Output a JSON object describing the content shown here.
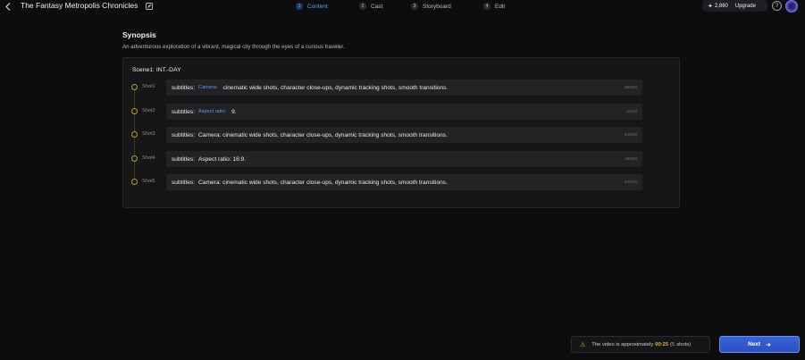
{
  "header": {
    "project_title": "The Fantasy Metropolis Chronicles",
    "steps": [
      {
        "number": "1",
        "label": "Content"
      },
      {
        "number": "2",
        "label": "Cast"
      },
      {
        "number": "3",
        "label": "Storyboard"
      },
      {
        "number": "4",
        "label": "Edit"
      }
    ],
    "active_step": "Content",
    "credits": "2,860",
    "upgrade_label": "Upgrade",
    "help_glyph": "?"
  },
  "synopsis": {
    "title": "Synopsis",
    "text": "An adventurous exploration of a vibrant, magical city through the eyes of a curious traveler."
  },
  "scene": {
    "title": "Scene1: INT.-DAY",
    "shots": [
      {
        "label": "Shot1",
        "prefix": "subtitles:",
        "tag": "Camera:",
        "text": "cinematic wide shots, character close-ups, dynamic tracking shots, smooth transitions.",
        "counter": "96/200"
      },
      {
        "label": "Shot2",
        "prefix": "subtitles:",
        "tag": "Aspect ratio:",
        "text": "9.",
        "counter": "2/200"
      },
      {
        "label": "Shot3",
        "prefix": "subtitles:",
        "tag": "",
        "text": "Camera: cinematic wide shots, character close-ups, dynamic tracking shots, smooth transitions.",
        "counter": "94/200"
      },
      {
        "label": "Shot4",
        "prefix": "subtitles:",
        "tag": "",
        "text": "Aspect ratio: 16:9.",
        "counter": "18/200"
      },
      {
        "label": "Shot5",
        "prefix": "subtitles:",
        "tag": "",
        "text": "Camera: cinematic wide shots, character close-ups, dynamic tracking shots, smooth transitions.",
        "counter": "94/200"
      }
    ]
  },
  "footer": {
    "duration_prefix": "The video is approximately",
    "duration_time": "00:25",
    "duration_shots_open": "(",
    "duration_shots_count": "5",
    "duration_shots_close": "shots)",
    "next_label": "Next"
  },
  "colors": {
    "accent_blue": "#4fa3ff",
    "duration_highlight": "#f2a93b",
    "next_button": "#3a63d9"
  }
}
